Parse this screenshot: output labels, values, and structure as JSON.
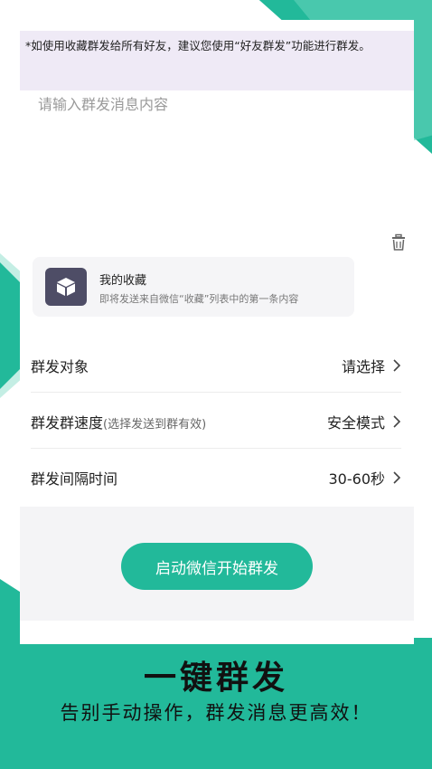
{
  "notice": {
    "text": "*如使用收藏群发给所有好友，建议您使用“好友群发”功能进行群发。"
  },
  "message_input": {
    "placeholder": "请输入群发消息内容"
  },
  "favorite": {
    "icon": "cube-icon",
    "title": "我的收藏",
    "description": "即将发送来自微信“收藏”列表中的第一条内容"
  },
  "settings": [
    {
      "label": "群发对象",
      "hint": "",
      "value": "请选择"
    },
    {
      "label": "群发群速度",
      "hint": "(选择发送到群有效)",
      "value": "安全模式"
    },
    {
      "label": "群发间隔时间",
      "hint": "",
      "value": "30-60秒"
    }
  ],
  "start_button": {
    "label": "启动微信开始群发"
  },
  "hero": {
    "title": "一键群发",
    "subtitle": "告别手动操作，群发消息更高效！"
  },
  "colors": {
    "accent": "#22b99a",
    "icon_bg": "#4e4d66"
  }
}
